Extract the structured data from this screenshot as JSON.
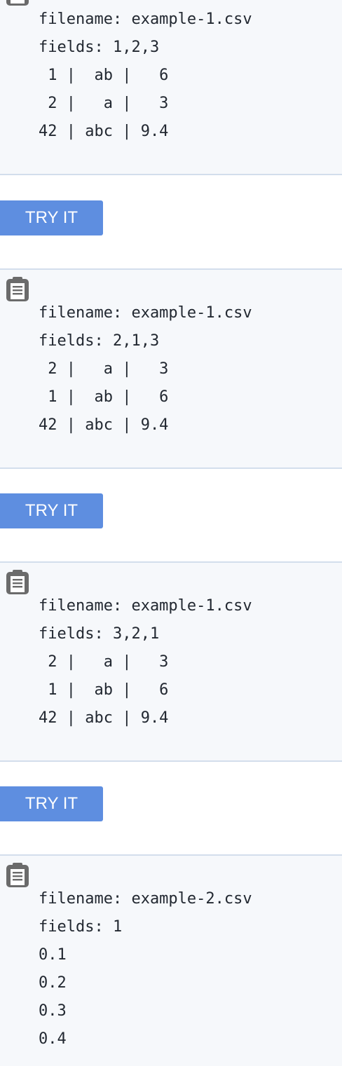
{
  "blocks": [
    {
      "lines": [
        "filename: example-1.csv",
        "fields: 1,2,3",
        " 1 |  ab |   6",
        " 2 |   a |   3",
        "42 | abc | 9.4"
      ],
      "copy_icon": "clipboard-icon"
    },
    {
      "lines": [
        "filename: example-1.csv",
        "fields: 2,1,3",
        " 2 |   a |   3",
        " 1 |  ab |   6",
        "42 | abc | 9.4"
      ],
      "copy_icon": "clipboard-icon"
    },
    {
      "lines": [
        "filename: example-1.csv",
        "fields: 3,2,1",
        " 2 |   a |   3",
        " 1 |  ab |   6",
        "42 | abc | 9.4"
      ],
      "copy_icon": "clipboard-icon"
    },
    {
      "lines": [
        "filename: example-2.csv",
        "fields: 1",
        "0.1",
        "0.2",
        "0.3",
        "0.4"
      ],
      "copy_icon": "clipboard-icon"
    }
  ],
  "try_buttons": [
    {
      "label": "TRY IT"
    },
    {
      "label": "TRY IT"
    },
    {
      "label": "TRY IT"
    }
  ],
  "colors": {
    "button": "#5e8ee0",
    "code_background": "#f6f8fb",
    "border": "#d3deec",
    "icon": "#6b6b6b"
  }
}
